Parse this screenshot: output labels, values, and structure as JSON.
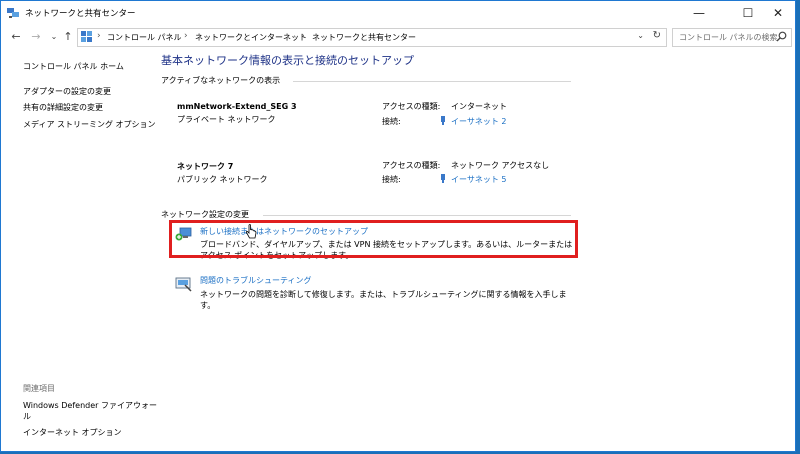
{
  "window": {
    "title": "ネットワークと共有センター",
    "minimize": "—",
    "maximize": "☐",
    "close": "✕"
  },
  "address": {
    "crumbs": [
      "コントロール パネル",
      "ネットワークとインターネット",
      "ネットワークと共有センター"
    ],
    "search_placeholder": "コントロール パネルの検索"
  },
  "sidebar": {
    "home": "コントロール パネル ホーム",
    "links": [
      "アダプターの設定の変更",
      "共有の詳細設定の変更",
      "メディア ストリーミング オプション"
    ],
    "related_heading": "関連項目",
    "related": [
      "Windows Defender ファイアウォー",
      "ル",
      "インターネット オプション"
    ]
  },
  "main": {
    "title": "基本ネットワーク情報の表示と接続のセットアップ",
    "active_label": "アクティブなネットワークの表示",
    "networks": [
      {
        "name": "mmNetwork-Extend_SEG 3",
        "type": "プライベート ネットワーク",
        "access_key": "アクセスの種類:",
        "access_val": "インターネット",
        "conn_key": "接続:",
        "conn_val": "イーサネット 2"
      },
      {
        "name": "ネットワーク 7",
        "type": "パブリック ネットワーク",
        "access_key": "アクセスの種類:",
        "access_val": "ネットワーク アクセスなし",
        "conn_key": "接続:",
        "conn_val": "イーサネット 5"
      }
    ],
    "change_label": "ネットワーク設定の変更",
    "tasks": [
      {
        "link": "新しい接続またはネットワークのセットアップ",
        "desc": "ブロードバンド、ダイヤルアップ、または VPN 接続をセットアップします。あるいは、ルーターまたはアクセス ポイントをセットアップします。"
      },
      {
        "link": "問題のトラブルシューティング",
        "desc": "ネットワークの問題を診断して修復します。または、トラブルシューティングに関する情報を入手します。"
      }
    ]
  },
  "colors": {
    "accent": "#1a6fc4",
    "title": "#1e3287",
    "highlight": "#e01f1f"
  }
}
